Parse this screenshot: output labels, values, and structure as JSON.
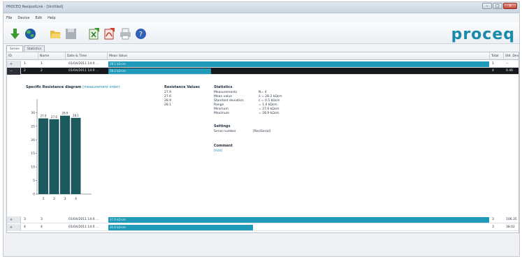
{
  "window": {
    "title": "PROCEQ ResipodLink - [Untitled]"
  },
  "menu": [
    "File",
    "Device",
    "Edit",
    "Help"
  ],
  "toolbar": {
    "icons": [
      "download-icon",
      "globe-icon",
      "folder-open-icon",
      "save-icon",
      "export-excel-icon",
      "export-pdf-icon",
      "print-icon",
      "help-icon"
    ],
    "logo": "proceq"
  },
  "tabs": [
    "Series",
    "Statistics"
  ],
  "columns": [
    "ID",
    "Name",
    "Date & Time",
    "Mean Value",
    "Total",
    "Std. Dev."
  ],
  "rows": [
    {
      "id": "1",
      "name": "1",
      "datetime": "01/04/2011 14:0 ...",
      "value_label": "28.1 kΩ·cm",
      "bar_fraction": 1.0,
      "total": "1",
      "stddev": "--",
      "expanded": false,
      "selected": false
    },
    {
      "id": "2",
      "name": "2",
      "datetime": "01/04/2011 14:0 ...",
      "value_label": "28.2 kΩ·cm",
      "bar_fraction": 0.27,
      "total": "4",
      "stddev": "0.46",
      "expanded": true,
      "selected": true
    },
    {
      "id": "3",
      "name": "3",
      "datetime": "01/04/2011 14:0 ...",
      "value_label": "37.6 kΩ·cm",
      "bar_fraction": 1.0,
      "total": "3",
      "stddev": "106.35",
      "expanded": false,
      "selected": false
    },
    {
      "id": "4",
      "name": "4",
      "datetime": "01/04/2011 14:0 ...",
      "value_label": "35.6 kΩ·cm",
      "bar_fraction": 0.38,
      "total": "3",
      "stddev": "38.02",
      "expanded": false,
      "selected": false
    }
  ],
  "detail": {
    "diagram_title": "Specific Resistance diagram",
    "diagram_subtitle": "(measurement order)",
    "resistance_heading": "Resistance Values",
    "resistance_values": [
      "27.9",
      "27.6",
      "28.9",
      "28.1"
    ],
    "statistics_heading": "Statistics",
    "stats": [
      {
        "label": "Measurements",
        "value": "N= 4"
      },
      {
        "label": "Mean value",
        "value": "x̄ = 28.2 kΩcm"
      },
      {
        "label": "Standard deviation",
        "value": "s = 0.5 kΩcm"
      },
      {
        "label": "Range",
        "value": "= 1.0 kΩcm"
      },
      {
        "label": "Minimum",
        "value": "= 27.6 kΩcm"
      },
      {
        "label": "Maximum",
        "value": "= 28.9 kΩcm"
      }
    ],
    "settings_heading": "Settings",
    "serial_label": "Serial number",
    "serial_value": "[ResiSerial]",
    "comment_heading": "Comment",
    "comment_value": "[Add]"
  },
  "chart_data": {
    "type": "bar",
    "categories": [
      "1",
      "2",
      "3",
      "4"
    ],
    "values": [
      27.9,
      27.6,
      28.9,
      28.1
    ],
    "data_labels": [
      "27.9",
      "27.6",
      "28.9",
      "28.1"
    ],
    "ylim": [
      0,
      35
    ],
    "yticks": [
      "0",
      "5",
      "10",
      "15",
      "20",
      "25",
      "30"
    ],
    "bar_color": "#1c5a5f"
  },
  "colors": {
    "accent": "#1f9ab8",
    "selected_row": "#16181b",
    "chart_bar": "#1c5a5f"
  }
}
